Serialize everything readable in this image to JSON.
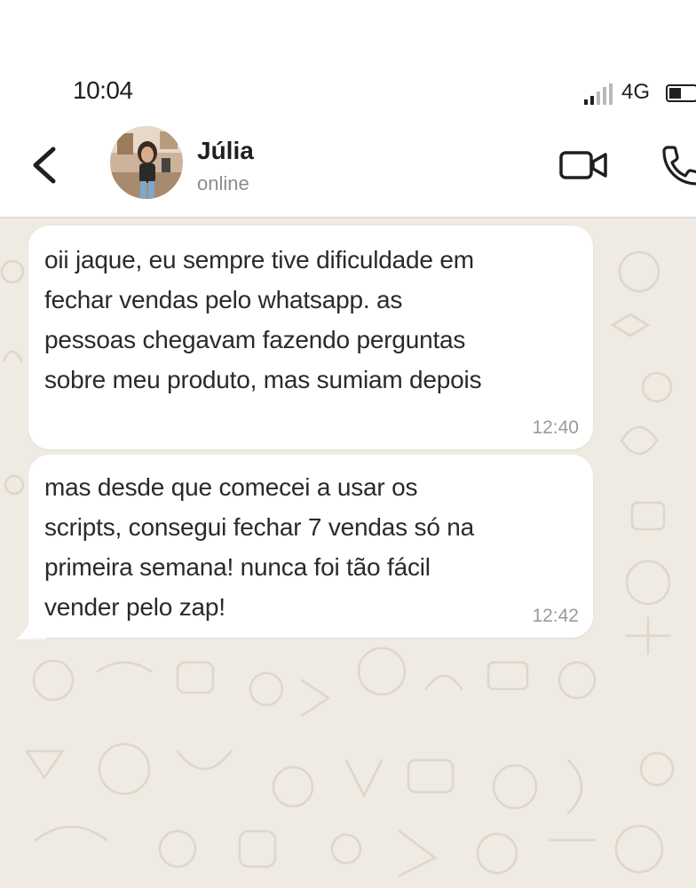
{
  "status_bar": {
    "time": "10:04",
    "network": "4G",
    "signal_icon": "signal-bars-icon",
    "battery_icon": "battery-icon"
  },
  "header": {
    "back_icon": "chevron-left-icon",
    "contact_name": "Júlia",
    "contact_status": "online",
    "video_icon": "video-camera-icon",
    "call_icon": "phone-icon"
  },
  "messages": [
    {
      "text": "oii jaque, eu sempre tive dificuldade em\nfechar vendas pelo whatsapp. as\npessoas chegavam fazendo perguntas\nsobre meu produto, mas sumiam depois",
      "time": "12:40"
    },
    {
      "text": "mas desde que comecei a usar os\nscripts, consegui fechar 7 vendas só na\nprimeira semana! nunca foi tão fácil\nvender pelo zap!",
      "time": "12:42"
    }
  ],
  "colors": {
    "chat_background": "#efeae2",
    "bubble": "#ffffff",
    "text": "#2a2a2a",
    "muted": "#9a9a9a"
  }
}
